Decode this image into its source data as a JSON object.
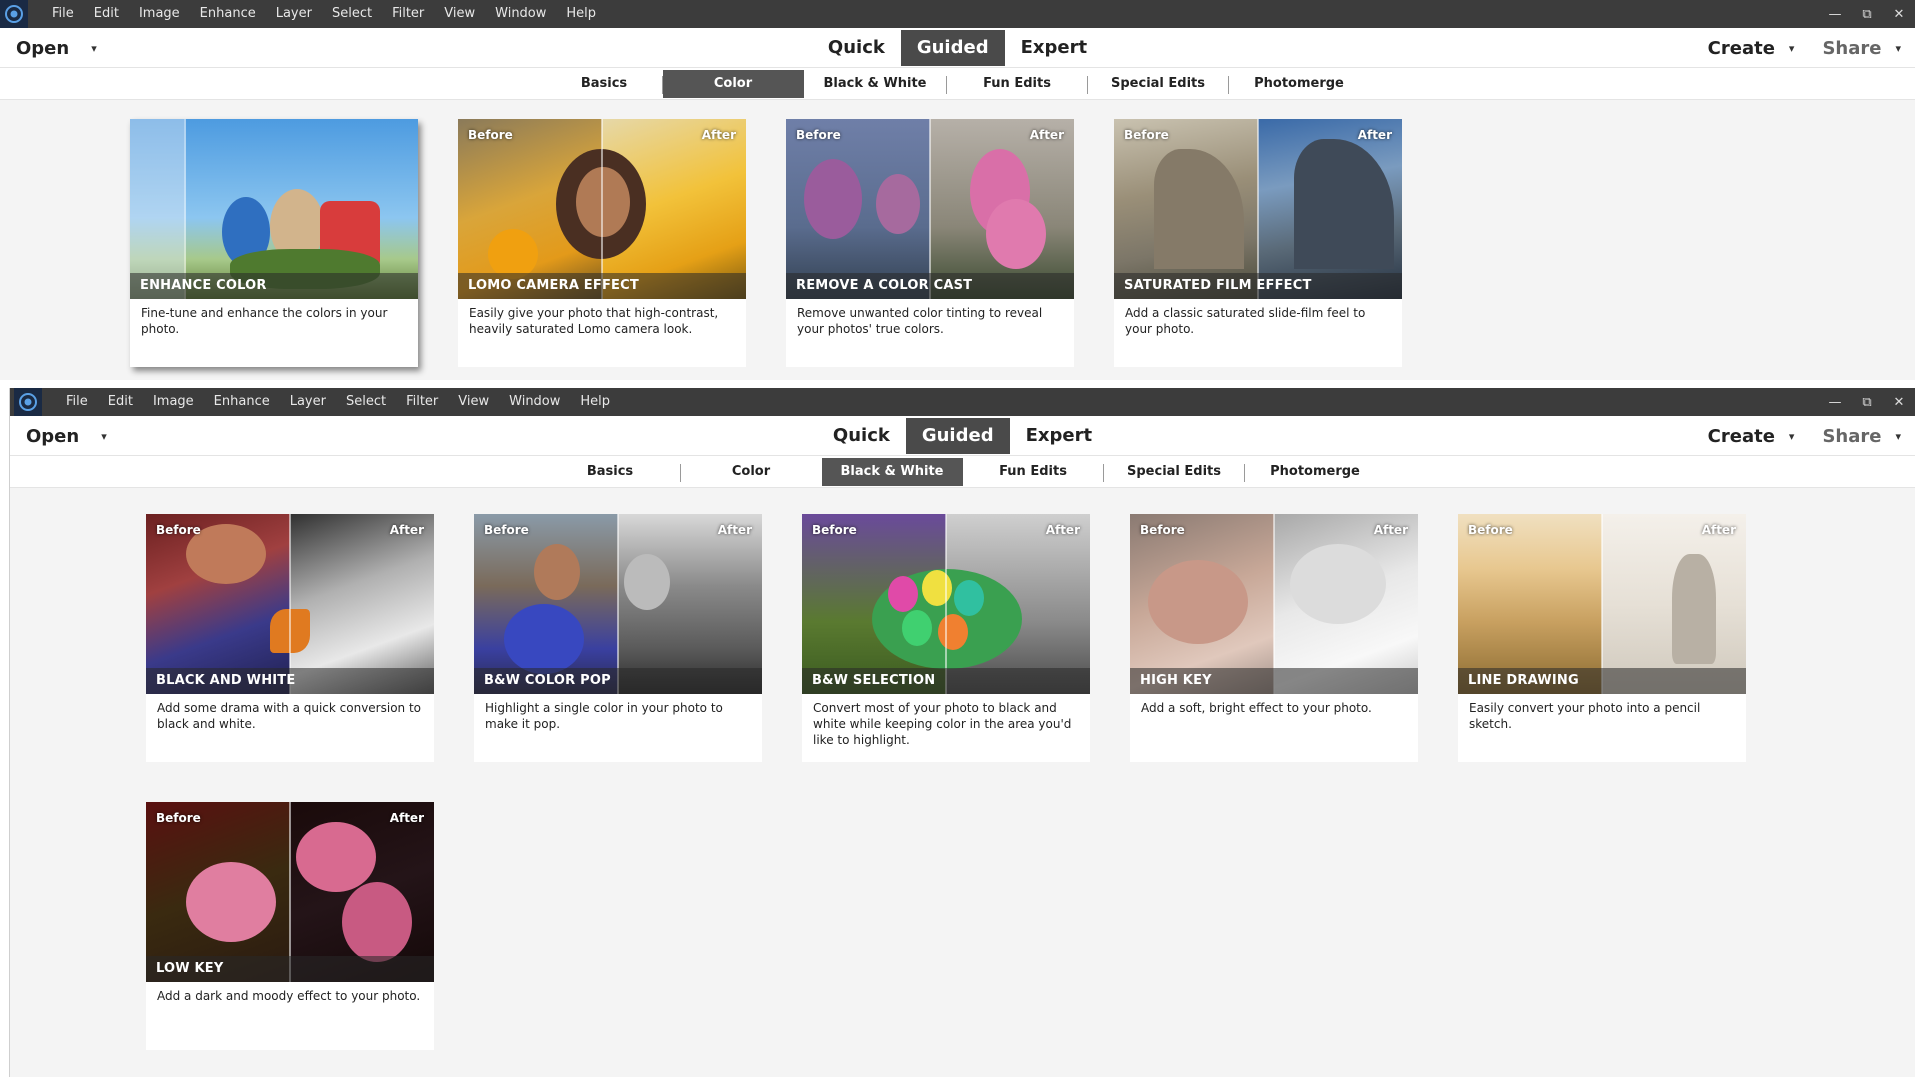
{
  "menu": [
    "File",
    "Edit",
    "Image",
    "Enhance",
    "Layer",
    "Select",
    "Filter",
    "View",
    "Window",
    "Help"
  ],
  "window_controls": {
    "minimize": "—",
    "restore": "⧉",
    "close": "✕"
  },
  "toolbar": {
    "open": "Open",
    "create": "Create",
    "share": "Share",
    "caret": "▾"
  },
  "modes": [
    "Quick",
    "Guided",
    "Expert"
  ],
  "subtabs": [
    "Basics",
    "Color",
    "Black & White",
    "Fun Edits",
    "Special Edits",
    "Photomerge"
  ],
  "labels": {
    "before": "Before",
    "after": "After"
  },
  "window1": {
    "active_mode": "Guided",
    "active_subtab": "Color",
    "cards": [
      {
        "title": "ENHANCE COLOR",
        "desc": "Fine-tune and enhance the colors in your photo.",
        "show_labels": false
      },
      {
        "title": "LOMO CAMERA EFFECT",
        "desc": "Easily give your photo that high-contrast, heavily saturated Lomo camera look.",
        "show_labels": true
      },
      {
        "title": "REMOVE A COLOR CAST",
        "desc": "Remove unwanted color tinting to reveal your photos' true colors.",
        "show_labels": true
      },
      {
        "title": "SATURATED FILM EFFECT",
        "desc": "Add a classic saturated slide-film feel to your photo.",
        "show_labels": true
      }
    ]
  },
  "window2": {
    "active_mode": "Guided",
    "active_subtab": "Black & White",
    "cards": [
      {
        "title": "BLACK AND WHITE",
        "desc": "Add some drama with a quick conversion to black and white.",
        "show_labels": true
      },
      {
        "title": "B&W COLOR POP",
        "desc": "Highlight a single color in your photo to make it pop.",
        "show_labels": true
      },
      {
        "title": "B&W SELECTION",
        "desc": "Convert most of your photo to black and white while keeping color in the area you'd like to highlight.",
        "show_labels": true
      },
      {
        "title": "HIGH KEY",
        "desc": "Add a soft, bright effect to your photo.",
        "show_labels": true
      },
      {
        "title": "LINE DRAWING",
        "desc": "Easily convert your photo into a pencil sketch.",
        "show_labels": true
      },
      {
        "title": "LOW KEY",
        "desc": "Add a dark and moody effect to your photo.",
        "show_labels": true
      }
    ]
  },
  "colors": {
    "menubar": "#3c3c3c",
    "active_tab": "#4a4a4a",
    "active_subtab": "#555555",
    "panel_bg": "#f4f4f4"
  }
}
